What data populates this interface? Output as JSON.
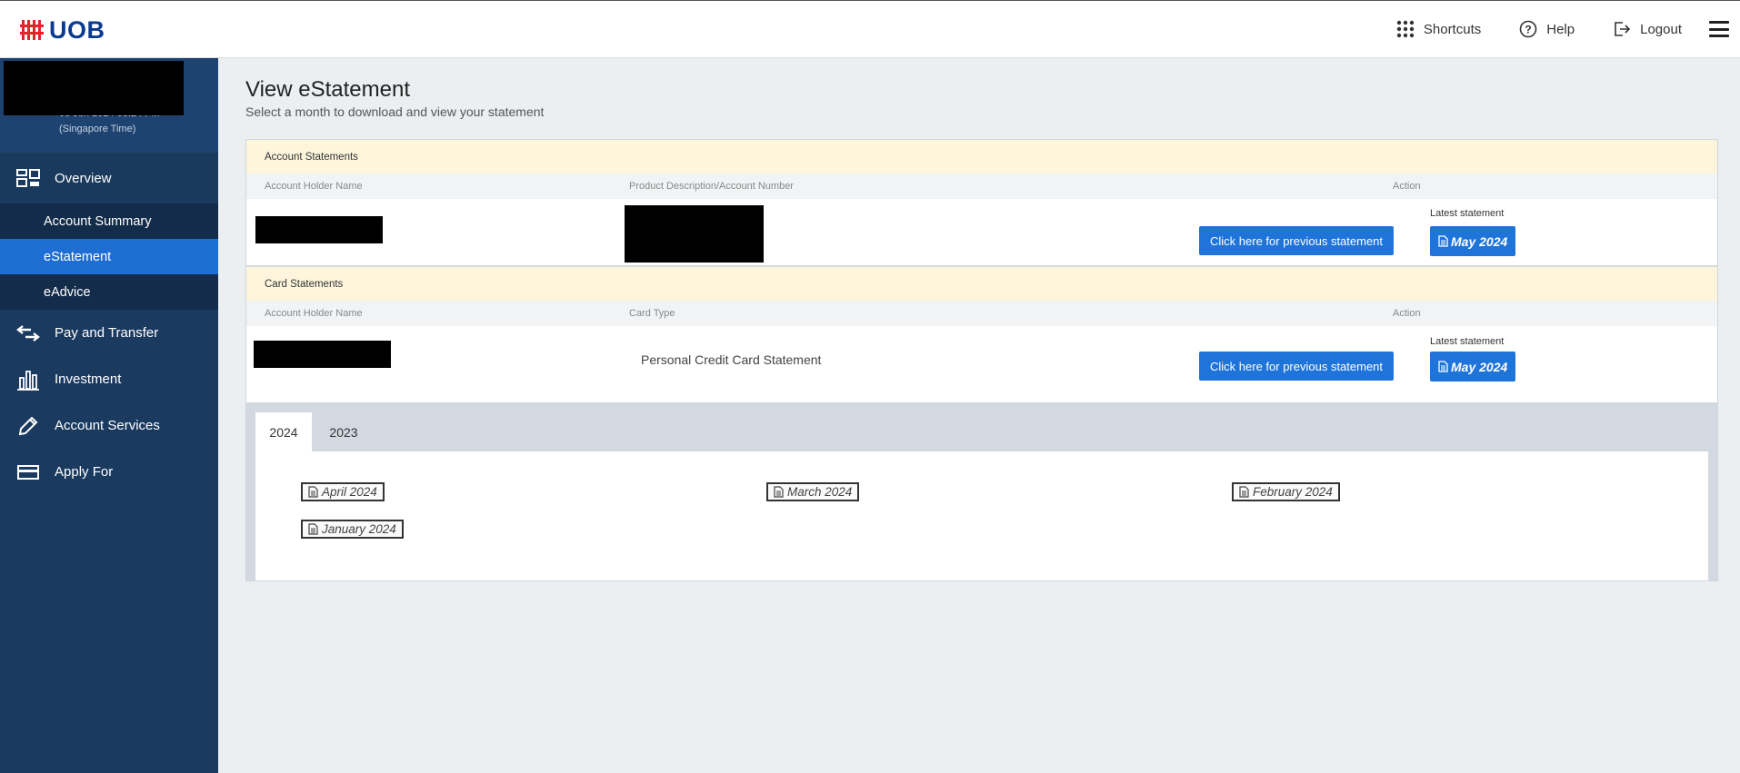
{
  "header": {
    "logo_text": "UOB",
    "nav": [
      {
        "label": "Shortcuts",
        "icon": "grid-icon"
      },
      {
        "label": "Help",
        "icon": "help-icon"
      },
      {
        "label": "Logout",
        "icon": "logout-icon"
      }
    ]
  },
  "sidebar": {
    "login_time_line1": "03 Jun 2024 08:24 PM",
    "login_time_line2": "(Singapore Time)",
    "overview_label": "Overview",
    "sub_items": [
      {
        "label": "Account Summary"
      },
      {
        "label": "eStatement"
      },
      {
        "label": "eAdvice"
      }
    ],
    "items": [
      {
        "label": "Pay and Transfer"
      },
      {
        "label": "Investment"
      },
      {
        "label": "Account Services"
      },
      {
        "label": "Apply For"
      }
    ]
  },
  "main": {
    "title": "View eStatement",
    "subtitle": "Select a month to download and view your statement",
    "account_section": {
      "heading": "Account Statements",
      "col_holder": "Account Holder Name",
      "col_product": "Product Description/Account Number",
      "col_action": "Action",
      "prev_button": "Click here for previous statement",
      "latest_label": "Latest statement",
      "latest_button": "May 2024"
    },
    "card_section": {
      "heading": "Card Statements",
      "col_holder": "Account Holder Name",
      "col_card_type": "Card Type",
      "col_action": "Action",
      "card_type": "Personal Credit Card Statement",
      "prev_button": "Click here for previous statement",
      "latest_label": "Latest statement",
      "latest_button": "May 2024"
    },
    "year_tabs": [
      {
        "label": "2024",
        "selected": true
      },
      {
        "label": "2023",
        "selected": false
      }
    ],
    "months": [
      {
        "label": "April 2024"
      },
      {
        "label": "March 2024"
      },
      {
        "label": "February 2024"
      },
      {
        "label": "January 2024"
      }
    ]
  },
  "colors": {
    "sidebar_bg": "#1b3a60",
    "active_blue": "#1f74d9",
    "section_header": "#fdf6dd",
    "brand_red": "#e0262b",
    "brand_blue": "#0b3b91"
  }
}
